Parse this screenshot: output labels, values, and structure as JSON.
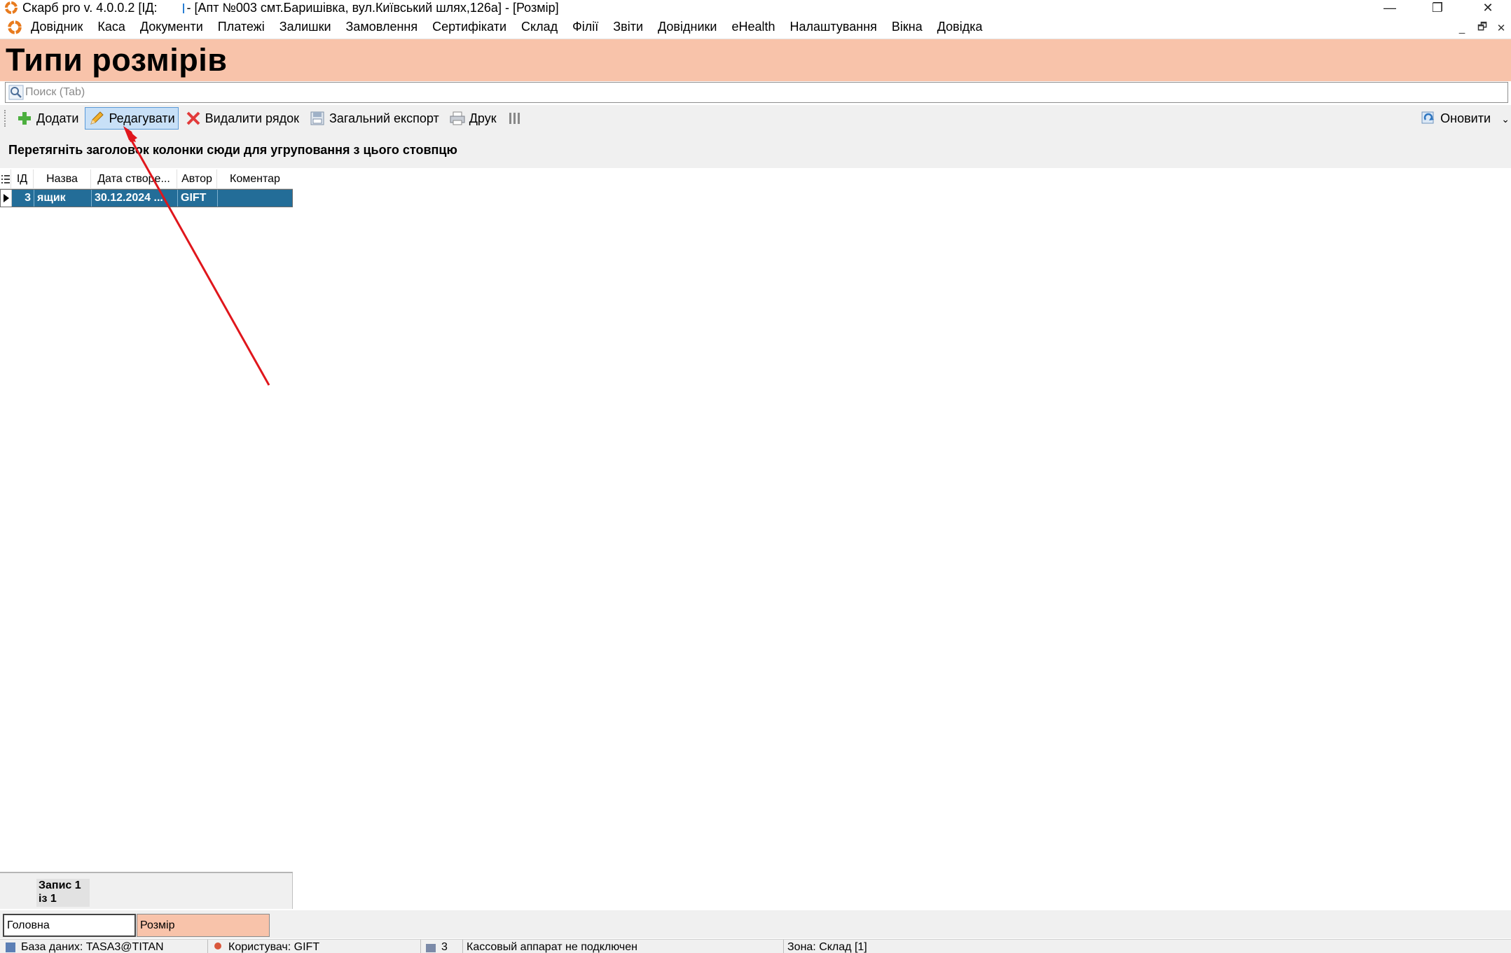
{
  "window": {
    "title_prefix": "Скарб pro v. 4.0.0.2 [ІД:",
    "title_suffix": "- [Апт №003 смт.Баришівка, вул.Київський шлях,126а] - [Розмір]",
    "minimize": "—",
    "restore": "❐",
    "close": "✕"
  },
  "menu": {
    "items": [
      "Довідник",
      "Каса",
      "Документи",
      "Платежі",
      "Залишки",
      "Замовлення",
      "Сертифікати",
      "Склад",
      "Філії",
      "Звіти",
      "Довідники",
      "eHealth",
      "Налаштування",
      "Вікна",
      "Довідка"
    ],
    "mdi_minimize": "_",
    "mdi_restore": "🗗",
    "mdi_close": "✕"
  },
  "header": {
    "title": "Типи розмірів"
  },
  "search": {
    "placeholder": "Поиск (Tab)"
  },
  "toolbar": {
    "add": "Додати",
    "edit": "Редагувати",
    "delete": "Видалити рядок",
    "export": "Загальний експорт",
    "print": "Друк",
    "refresh": "Оновити"
  },
  "group_panel": {
    "hint": "Перетягніть заголовок колонки сюди для угруповання з цього стовпцю"
  },
  "grid": {
    "columns": [
      "ІД",
      "Назва",
      "Дата створе...",
      "Автор",
      "Коментар"
    ],
    "rows": [
      {
        "id": "3",
        "name": "ящик",
        "date": "30.12.2024 ...",
        "author": "GIFT",
        "comment": ""
      }
    ]
  },
  "footer": {
    "record_line1": "Запис 1",
    "record_line2": "із 1"
  },
  "tabs": {
    "home": "Головна",
    "current": "Розмір"
  },
  "statusbar": {
    "database": "База даних: TASA3@TITAN",
    "user": "Користувач: GIFT",
    "counter": "3",
    "cash_register": "Кассовый аппарат не подключен",
    "zone": "Зона: Склад [1]"
  },
  "colors": {
    "header_band": "#f8c3aa",
    "selected_row": "#236d98",
    "active_button": "#c8e0f7",
    "annotation_arrow": "#e0161c"
  }
}
